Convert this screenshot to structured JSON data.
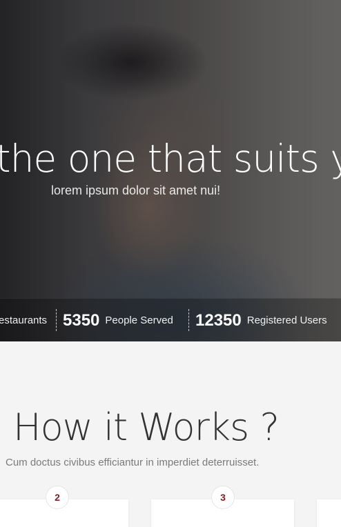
{
  "hero": {
    "headline": "the one that suits you",
    "subtitle": "lorem ipsum dolor sit amet nui!"
  },
  "stats": [
    {
      "number": "",
      "label": "estaurants"
    },
    {
      "number": "5350",
      "label": "People Served"
    },
    {
      "number": "12350",
      "label": "Registered Users"
    }
  ],
  "how_it_works": {
    "title": "How it Works ?",
    "subtitle": "Cum doctus civibus efficiantur in imperdiet deterruisset.",
    "steps": [
      {
        "number": "2"
      },
      {
        "number": "3"
      }
    ]
  },
  "colors": {
    "accent": "#8b1a1a",
    "page_bg": "#f4f4f4",
    "title_text": "#333333"
  }
}
